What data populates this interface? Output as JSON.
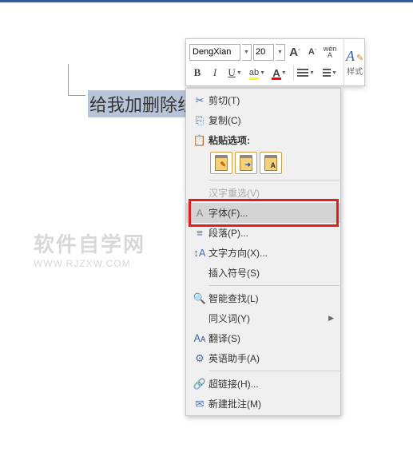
{
  "toolbar": {
    "font_name": "DengXian",
    "font_size": "20",
    "styles_label": "样式"
  },
  "document": {
    "selected_text": "给我加删除线吧"
  },
  "watermark": {
    "main": "软件自学网",
    "sub": "WWW.RJZXW.COM"
  },
  "menu": {
    "cut": "剪切(T)",
    "copy": "复制(C)",
    "paste_options": "粘贴选项:",
    "hanzi": "汉字重选(V)",
    "font": "字体(F)...",
    "paragraph": "段落(P)...",
    "text_direction": "文字方向(X)...",
    "insert_symbol": "插入符号(S)",
    "smart_lookup": "智能查找(L)",
    "synonyms": "同义词(Y)",
    "translate": "翻译(S)",
    "english_assistant": "英语助手(A)",
    "hyperlink": "超链接(H)...",
    "new_comment": "新建批注(M)"
  }
}
